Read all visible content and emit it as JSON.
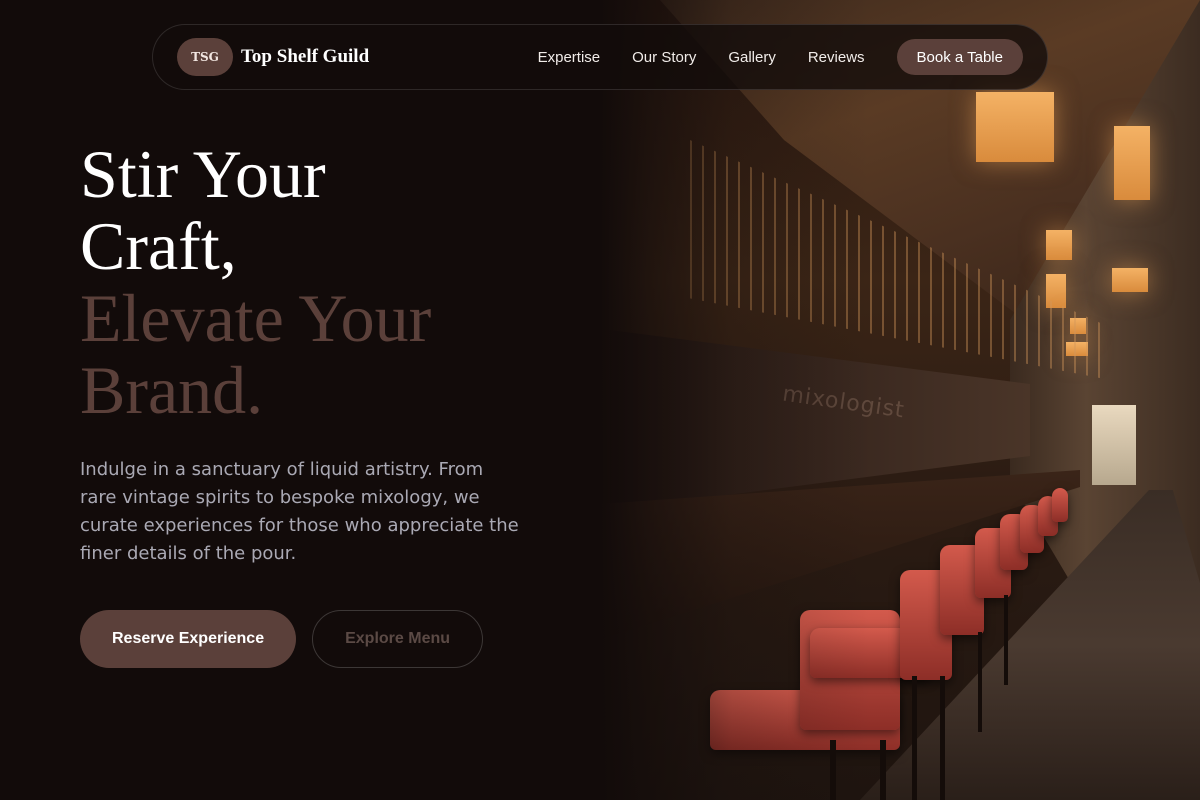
{
  "brand": {
    "logo_initials": "TSG",
    "name": "Top Shelf Guild"
  },
  "nav": {
    "links": [
      "Expertise",
      "Our Story",
      "Gallery",
      "Reviews"
    ],
    "cta_label": "Book a Table"
  },
  "hero": {
    "headline_line1": "Stir Your",
    "headline_line2": "Craft,",
    "headline_line3": "Elevate Your",
    "headline_line4": "Brand.",
    "lead": "Indulge in a sanctuary of liquid artistry. From rare vintage spirits to bespoke mixology, we curate experiences for those who appreciate the finer details of the pour.",
    "primary_cta": "Reserve Experience",
    "secondary_cta": "Explore Menu"
  },
  "photo": {
    "overlay_text": "mixologist"
  },
  "colors": {
    "background": "#120b0a",
    "accent": "#5b403a",
    "text": "#ffffff",
    "muted": "#aaa9b4"
  }
}
